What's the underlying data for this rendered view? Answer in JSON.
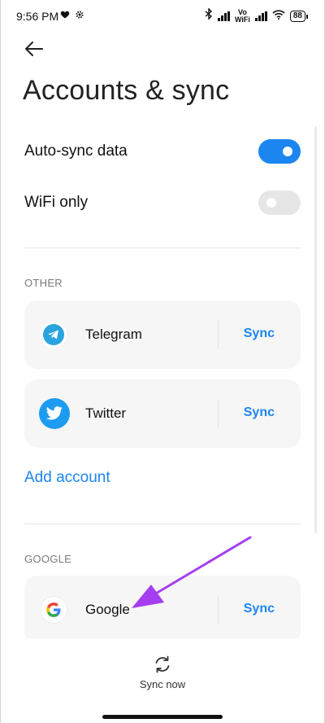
{
  "status_bar": {
    "time": "9:56 PM",
    "volte_line1": "Vo",
    "volte_line2": "WiFi",
    "battery": "88"
  },
  "header": {
    "title": "Accounts & sync"
  },
  "settings": {
    "auto_sync_label": "Auto-sync data",
    "auto_sync_on": true,
    "wifi_only_label": "WiFi only",
    "wifi_only_on": false
  },
  "sections": {
    "other": "OTHER",
    "google": "GOOGLE"
  },
  "accounts": [
    {
      "name": "Telegram",
      "action": "Sync"
    },
    {
      "name": "Twitter",
      "action": "Sync"
    },
    {
      "name": "Google",
      "action": "Sync"
    }
  ],
  "add_account": "Add account",
  "footer": {
    "sync_now": "Sync now"
  },
  "colors": {
    "accent": "#1b86f0",
    "annotation_arrow": "#a43ef0"
  }
}
